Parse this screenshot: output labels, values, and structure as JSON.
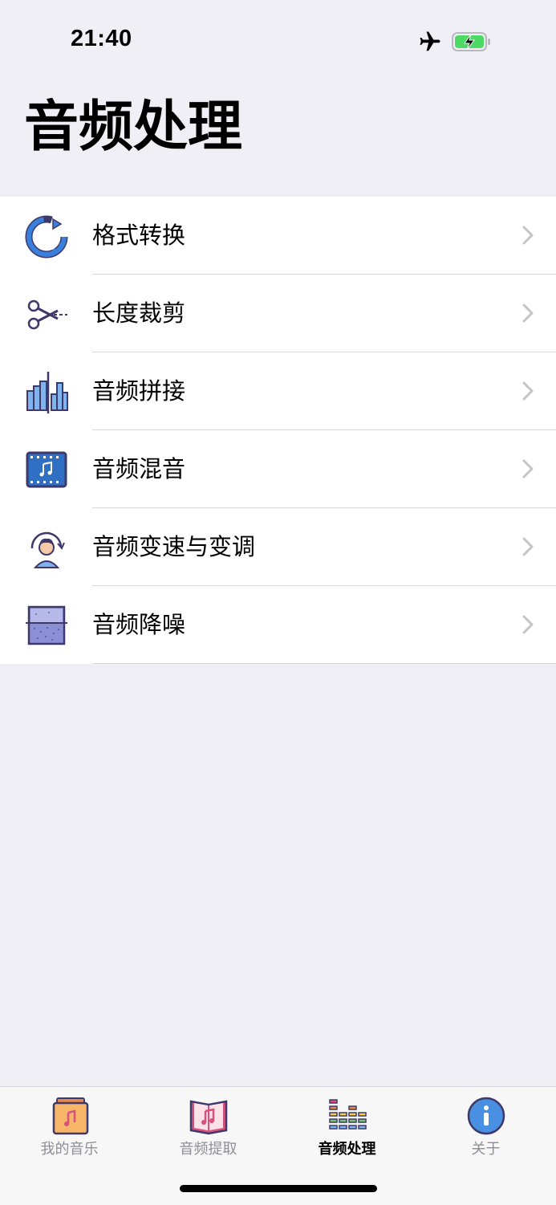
{
  "status": {
    "time": "21:40",
    "airplane_mode": true,
    "battery": "charging"
  },
  "header": {
    "title": "音频处理"
  },
  "menu": {
    "items": [
      {
        "label": "格式转换",
        "icon": "refresh-circle-icon"
      },
      {
        "label": "长度裁剪",
        "icon": "scissors-icon"
      },
      {
        "label": "音频拼接",
        "icon": "bar-chart-splice-icon"
      },
      {
        "label": "音频混音",
        "icon": "music-film-icon"
      },
      {
        "label": "音频变速与变调",
        "icon": "person-headphones-icon"
      },
      {
        "label": "音频降噪",
        "icon": "noise-grid-icon"
      }
    ]
  },
  "tabs": {
    "items": [
      {
        "label": "我的音乐",
        "icon": "music-folder-icon",
        "active": false
      },
      {
        "label": "音频提取",
        "icon": "music-book-icon",
        "active": false
      },
      {
        "label": "音频处理",
        "icon": "equalizer-icon",
        "active": true
      },
      {
        "label": "关于",
        "icon": "info-icon",
        "active": false
      }
    ]
  },
  "colors": {
    "background": "#f0eff5",
    "icon_blue": "#3a7fdc",
    "icon_outline": "#3d3a6b",
    "battery_green": "#4cd964",
    "info_blue": "#4a90e2"
  }
}
